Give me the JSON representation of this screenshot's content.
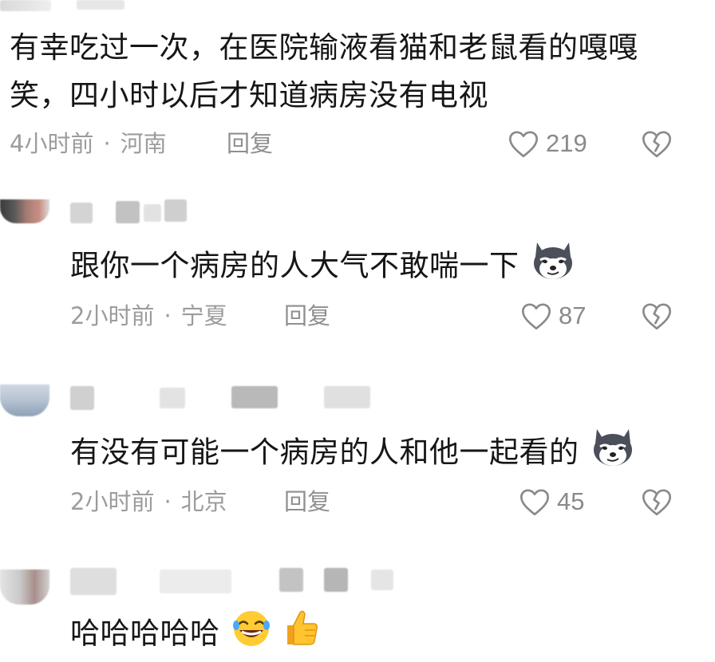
{
  "comments": [
    {
      "text_lines": [
        "有幸吃过一次，在医院输液看猫和老鼠看的嘎嘎",
        "笑，四小时以后才知道病房没有电视"
      ],
      "time": "4小时前",
      "location": "河南",
      "reply_label": "回复",
      "likes": "219"
    },
    {
      "text": "跟你一个病房的人大气不敢喘一下",
      "emoji": "husky-smirk",
      "time": "2小时前",
      "location": "宁夏",
      "reply_label": "回复",
      "likes": "87"
    },
    {
      "text": "有没有可能一个病房的人和他一起看的",
      "emoji": "husky-smirk",
      "time": "2小时前",
      "location": "北京",
      "reply_label": "回复",
      "likes": "45"
    },
    {
      "text": "哈哈哈哈哈",
      "emojis": [
        "rolling-laughing",
        "thumbs-up"
      ]
    }
  ],
  "separator": "·",
  "colors": {
    "text": "#161616",
    "meta": "#9c9c9c",
    "icon": "#8a8a8a"
  },
  "icons": [
    "heart-outline-icon",
    "broken-heart-icon"
  ]
}
